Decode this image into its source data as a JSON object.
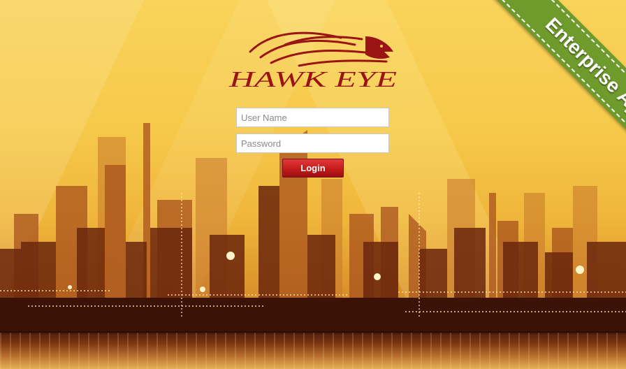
{
  "login": {
    "username_placeholder": "User Name",
    "password_placeholder": "Password",
    "login_label": "Login"
  },
  "ribbon": {
    "label": "Enterprise App"
  },
  "logo": {
    "text": "HAWK EYE"
  },
  "colors": {
    "background": "#f6c94a",
    "login_button": "#c41b1b",
    "ribbon": "#6f9a2c",
    "logo": "#9a1414"
  }
}
